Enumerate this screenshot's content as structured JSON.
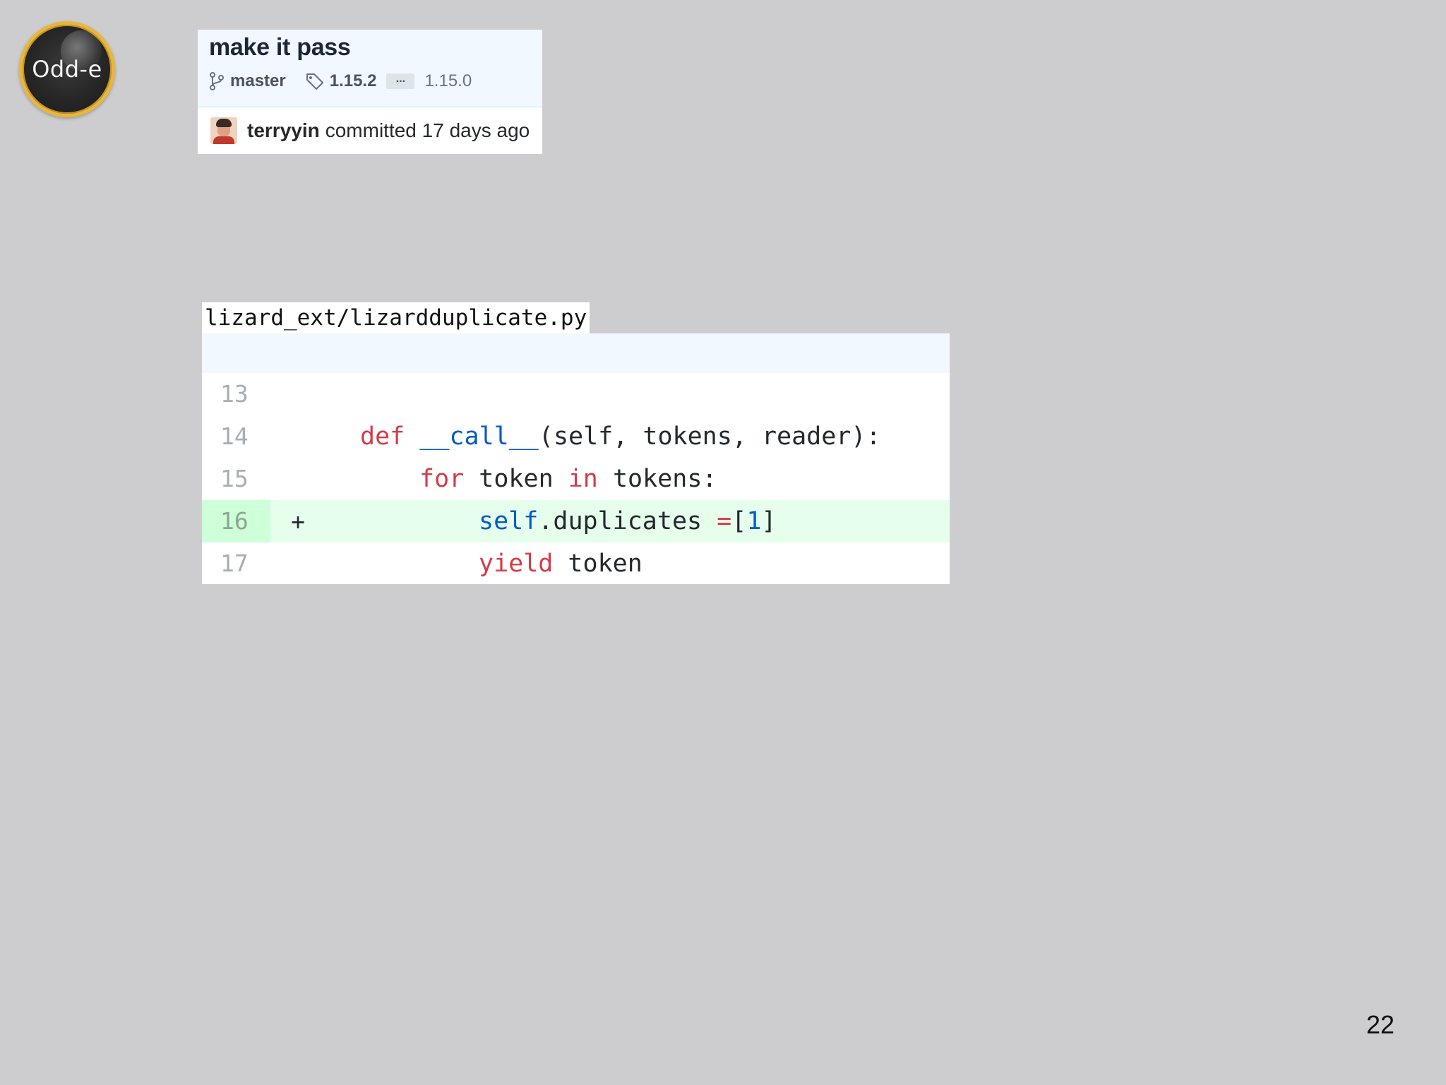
{
  "logo": {
    "text": "Odd-e",
    "ring_color": "#e8b63a"
  },
  "commit": {
    "title": "make it pass",
    "branch_icon": "git-branch-icon",
    "branch": "master",
    "tag_icon": "tag-icon",
    "tag_latest": "1.15.2",
    "ellipsis": "...",
    "tag_oldest": "1.15.0",
    "author": "terryyin",
    "committed_text": "committed 17 days ago"
  },
  "file": {
    "path": "lizard_ext/lizardduplicate.py"
  },
  "diff": {
    "lines": [
      {
        "num": "13",
        "marker": ""
      },
      {
        "num": "14",
        "marker": "",
        "kw1": "def",
        "fn": "__call__",
        "rest": "(self, tokens, reader):"
      },
      {
        "num": "15",
        "marker": "",
        "kw1": "for",
        "mid": " token ",
        "kw2": "in",
        "rest": " tokens:"
      },
      {
        "num": "16",
        "marker": "+",
        "fn": "self",
        "mid": ".duplicates ",
        "op": "=",
        "bracket_open": "[",
        "num_val": "1",
        "bracket_close": "]"
      },
      {
        "num": "17",
        "marker": "",
        "kw1": "yield",
        "rest": " token"
      }
    ],
    "colors": {
      "keyword": "#d73a49",
      "function": "#005cc5",
      "added_bg": "#e6ffed",
      "added_gutter": "#cdffd8"
    }
  },
  "page": {
    "number": "22"
  }
}
